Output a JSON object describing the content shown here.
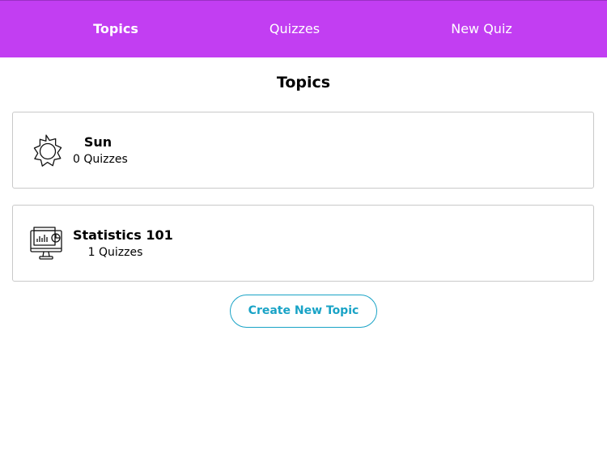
{
  "nav": {
    "items": [
      {
        "label": "Topics",
        "active": true
      },
      {
        "label": "Quizzes",
        "active": false
      },
      {
        "label": "New Quiz",
        "active": false
      }
    ],
    "background_color": "#c23ef2"
  },
  "page": {
    "title": "Topics"
  },
  "topics": [
    {
      "name": "Sun",
      "count_label": "0 Quizzes",
      "icon": "sun-icon"
    },
    {
      "name": "Statistics 101",
      "count_label": "1 Quizzes",
      "icon": "computer-chart-icon"
    }
  ],
  "actions": {
    "create_label": "Create New Topic",
    "accent_color": "#19a3c6"
  }
}
